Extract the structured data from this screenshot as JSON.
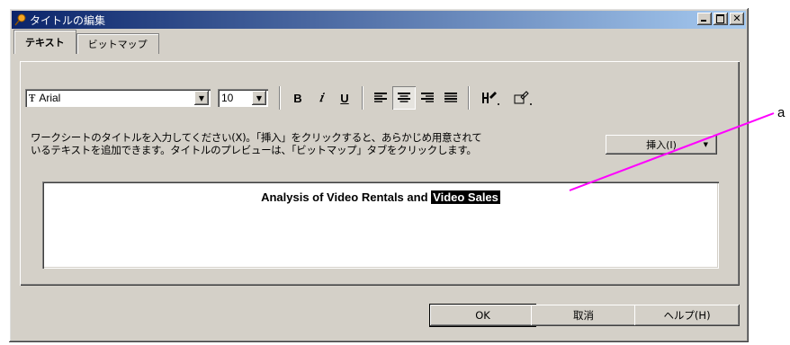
{
  "window": {
    "title": "タイトルの編集",
    "title_icon": "pin-icon",
    "caption_buttons": [
      "_",
      "□",
      "×"
    ]
  },
  "tabs": [
    {
      "label": "テキスト",
      "active": true
    },
    {
      "label": "ビットマップ",
      "active": false
    }
  ],
  "toolbar": {
    "font": {
      "icon": "Ŧ",
      "value": "Arial"
    },
    "size": {
      "value": "10"
    },
    "bold_label": "B",
    "italic_label": "𝑖",
    "underline_label": "U",
    "alignment": {
      "selected": "center",
      "options": [
        "left",
        "center",
        "right",
        "justify"
      ]
    },
    "text_color_icon": "pen-icon",
    "fill_color_icon": "fill-icon"
  },
  "instructions": {
    "line1": "ワークシートのタイトルを入力してください(X)。「挿入」をクリックすると、あらかじめ用意されて",
    "line2": "いるテキストを追加できます。タイトルのプレビューは、「ビットマップ」タブをクリックします。"
  },
  "insert_button": {
    "label": "挿入(I)"
  },
  "editor": {
    "text_normal": "Analysis of Video Rentals and ",
    "text_selected": "Video Sales"
  },
  "buttons": {
    "ok": "OK",
    "cancel": "取消",
    "help": "ヘルプ(H)"
  },
  "callout": {
    "label": "a",
    "color": "#ff00ff"
  },
  "colors": {
    "dialog_face": "#d4d0c8",
    "titlebar_start": "#0a246a",
    "titlebar_end": "#a6caf0"
  }
}
